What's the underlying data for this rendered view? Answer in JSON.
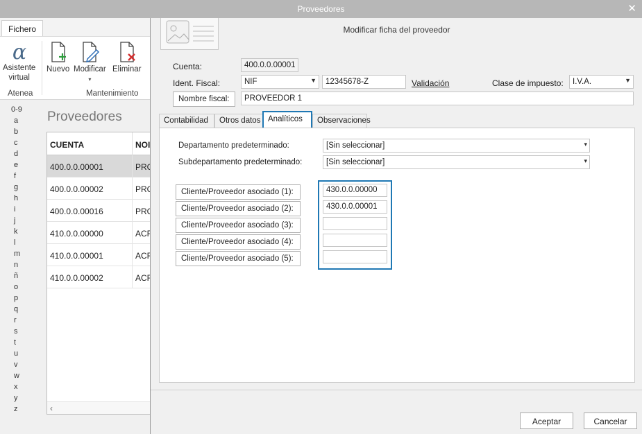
{
  "window": {
    "title": "Proveedores"
  },
  "ribbon": {
    "tab": "Fichero",
    "assistant_label": "Asistente virtual",
    "assistant_line1": "Asistente",
    "assistant_line2": "virtual",
    "group_atenea": "Atenea",
    "new_label": "Nuevo",
    "edit_label": "Modificar",
    "delete_label": "Eliminar",
    "group_maintenance": "Mantenimiento"
  },
  "alphabet": [
    "0-9",
    "a",
    "b",
    "c",
    "d",
    "e",
    "f",
    "g",
    "h",
    "i",
    "j",
    "k",
    "l",
    "m",
    "n",
    "ñ",
    "o",
    "p",
    "q",
    "r",
    "s",
    "t",
    "u",
    "v",
    "w",
    "x",
    "y",
    "z"
  ],
  "list": {
    "title": "Proveedores",
    "columns": [
      "CUENTA",
      "NOI"
    ],
    "rows": [
      {
        "cuenta": "400.0.0.00001",
        "nombre": "PRO"
      },
      {
        "cuenta": "400.0.0.00002",
        "nombre": "PRO"
      },
      {
        "cuenta": "400.0.0.00016",
        "nombre": "PRO"
      },
      {
        "cuenta": "410.0.0.00000",
        "nombre": "ACR"
      },
      {
        "cuenta": "410.0.0.00001",
        "nombre": "ACR"
      },
      {
        "cuenta": "410.0.0.00002",
        "nombre": "ACR"
      }
    ],
    "scroll_left": "‹",
    "expand": "›"
  },
  "modal": {
    "title": "Modificar ficha del proveedor",
    "cuenta_label": "Cuenta:",
    "cuenta_value": "400.0.0.00001",
    "ident_label": "Ident. Fiscal:",
    "ident_type": "NIF",
    "ident_value": "12345678-Z",
    "validacion": "Validación",
    "clase_label": "Clase de impuesto:",
    "clase_value": "I.V.A.",
    "nombre_label": "Nombre fiscal:",
    "nombre_value": "PROVEEDOR 1",
    "tabs": [
      "Contabilidad",
      "Otros datos",
      "Analíticos",
      "Observaciones"
    ],
    "active_tab": "Analíticos",
    "depto_label": "Departamento predeterminado:",
    "depto_value": "[Sin seleccionar]",
    "subdepto_label": "Subdepartamento predeterminado:",
    "subdepto_value": "[Sin seleccionar]",
    "asociados": [
      {
        "label": "Cliente/Proveedor asociado (1):",
        "value": "430.0.0.00000"
      },
      {
        "label": "Cliente/Proveedor asociado (2):",
        "value": "430.0.0.00001"
      },
      {
        "label": "Cliente/Proveedor asociado (3):",
        "value": ""
      },
      {
        "label": "Cliente/Proveedor asociado (4):",
        "value": ""
      },
      {
        "label": "Cliente/Proveedor asociado (5):",
        "value": ""
      }
    ],
    "accept": "Aceptar",
    "cancel": "Cancelar"
  },
  "colors": {
    "highlight": "#1f78b4",
    "titlebar": "#b7b7b7"
  }
}
